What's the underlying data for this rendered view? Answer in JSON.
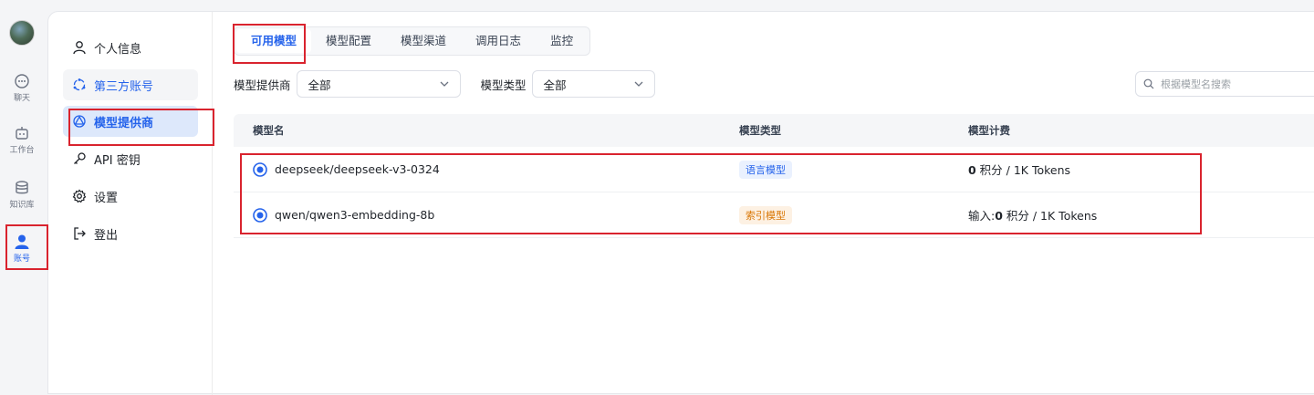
{
  "rail": {
    "items": [
      {
        "label": "聊天",
        "icon": "chat-icon"
      },
      {
        "label": "工作台",
        "icon": "robot-icon"
      },
      {
        "label": "知识库",
        "icon": "database-icon"
      },
      {
        "label": "账号",
        "icon": "user-icon"
      }
    ]
  },
  "sidenav": {
    "items": [
      {
        "label": "个人信息",
        "icon": "user-outline-icon"
      },
      {
        "label": "第三方账号",
        "icon": "share-icon"
      },
      {
        "label": "模型提供商",
        "icon": "provider-icon"
      },
      {
        "label": "API 密钥",
        "icon": "key-icon"
      },
      {
        "label": "设置",
        "icon": "gear-icon"
      },
      {
        "label": "登出",
        "icon": "logout-icon"
      }
    ]
  },
  "tabs": [
    "可用模型",
    "模型配置",
    "模型渠道",
    "调用日志",
    "监控"
  ],
  "filters": {
    "provider_label": "模型提供商",
    "provider_value": "全部",
    "type_label": "模型类型",
    "type_value": "全部",
    "search_placeholder": "根据模型名搜索"
  },
  "table": {
    "headers": [
      "模型名",
      "模型类型",
      "模型计费"
    ],
    "rows": [
      {
        "name": "deepseek/deepseek-v3-0324",
        "type": "语言模型",
        "type_color": "blue",
        "price_prefix": "",
        "price_value": "0",
        "price_suffix": " 积分 / 1K Tokens"
      },
      {
        "name": "qwen/qwen3-embedding-8b",
        "type": "索引模型",
        "type_color": "orange",
        "price_prefix": "输入:",
        "price_value": "0",
        "price_suffix": " 积分 / 1K Tokens"
      }
    ]
  },
  "colors": {
    "accent": "#2563eb",
    "highlight": "#d9232e"
  }
}
